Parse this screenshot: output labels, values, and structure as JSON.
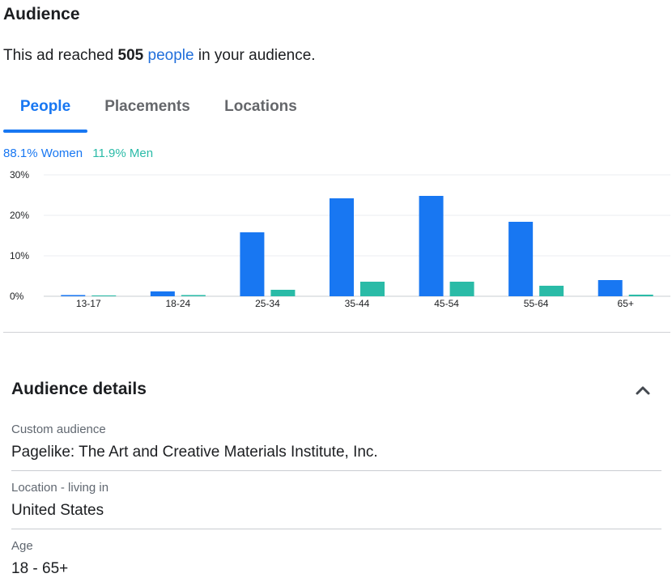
{
  "audience": {
    "title": "Audience",
    "reach_prefix": "This ad reached ",
    "reach_count": "505",
    "reach_link": "people",
    "reach_suffix": " in your audience."
  },
  "tabs": [
    {
      "label": "People",
      "active": true
    },
    {
      "label": "Placements",
      "active": false
    },
    {
      "label": "Locations",
      "active": false
    }
  ],
  "gender": {
    "women_label": "88.1% Women",
    "men_label": "11.9% Men"
  },
  "colors": {
    "women": "#1877f2",
    "men": "#2abba7",
    "accent": "#1877f2",
    "link": "#216fdb"
  },
  "chart_data": {
    "type": "bar",
    "categories": [
      "13-17",
      "18-24",
      "25-34",
      "35-44",
      "45-54",
      "55-64",
      "65+"
    ],
    "series": [
      {
        "name": "Women",
        "values": [
          0.3,
          1.2,
          15.8,
          24.2,
          24.8,
          18.4,
          4.0
        ]
      },
      {
        "name": "Men",
        "values": [
          0.2,
          0.3,
          1.6,
          3.6,
          3.6,
          2.6,
          0.4
        ]
      }
    ],
    "yticks": [
      "0%",
      "10%",
      "20%",
      "30%"
    ],
    "ylim": [
      0,
      30
    ],
    "grid": true,
    "title": "",
    "xlabel": "",
    "ylabel": ""
  },
  "details": {
    "title": "Audience details",
    "items": [
      {
        "label": "Custom audience",
        "value": "Pagelike: The Art and Creative Materials Institute, Inc."
      },
      {
        "label": "Location - living in",
        "value": "United States"
      },
      {
        "label": "Age",
        "value": "18 - 65+"
      }
    ]
  }
}
